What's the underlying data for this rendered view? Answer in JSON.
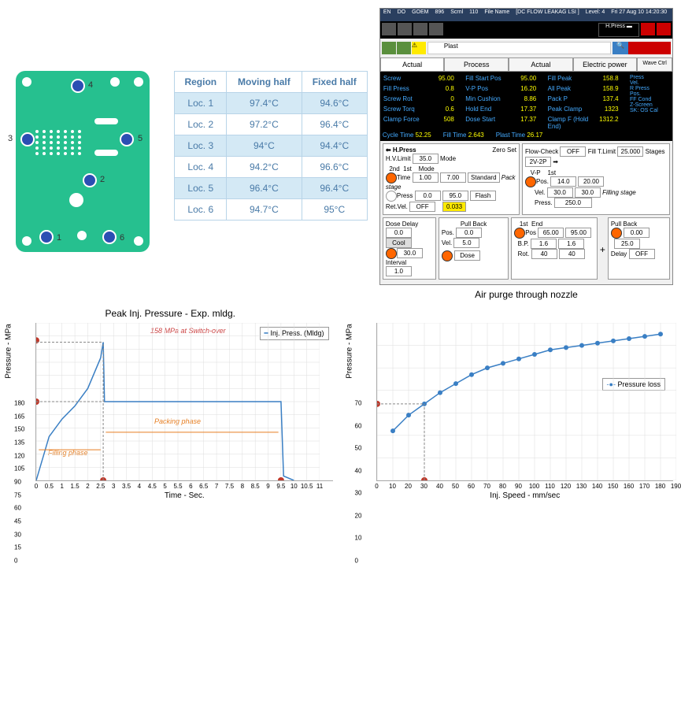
{
  "pcb": {
    "labels": [
      "1",
      "2",
      "3",
      "4",
      "5",
      "6"
    ]
  },
  "table": {
    "headers": [
      "Region",
      "Moving half",
      "Fixed half"
    ],
    "rows": [
      [
        "Loc. 1",
        "97.4°C",
        "94.6°C"
      ],
      [
        "Loc. 2",
        "97.2°C",
        "96.4°C"
      ],
      [
        "Loc. 3",
        "94°C",
        "94.4°C"
      ],
      [
        "Loc. 4",
        "94.2°C",
        "96.6°C"
      ],
      [
        "Loc. 5",
        "96.4°C",
        "96.4°C"
      ],
      [
        "Loc. 6",
        "94.7°C",
        "95°C"
      ]
    ]
  },
  "hmi": {
    "caption": "Air purge through nozzle",
    "toolbar_items": [
      "EN",
      "DO",
      "GOEM",
      "896",
      "Scrnl",
      "110",
      "File Name",
      "[DC FLOW LEAKAG LSI ]",
      "Level: 4",
      "Fri 27 Aug 10 14:20:30"
    ],
    "search_text": "Plast",
    "tabs": [
      "Actual",
      "Process",
      "Actual",
      "Electric power"
    ],
    "wave_label": "Wave Ctrl",
    "rows_left": [
      {
        "l": "Screw",
        "v": "95.00"
      },
      {
        "l": "Fill Press",
        "v": "0.8"
      },
      {
        "l": "Screw Rot",
        "v": "0"
      },
      {
        "l": "Screw Torq",
        "v": "0.6"
      },
      {
        "l": "Clamp Force",
        "v": "508"
      }
    ],
    "rows_mid": [
      {
        "l": "Fill Start Pos",
        "v": "95.00"
      },
      {
        "l": "V-P Pos",
        "v": "16.20"
      },
      {
        "l": "Min Cushion",
        "v": "8.86"
      },
      {
        "l": "Hold End",
        "v": "17.37"
      },
      {
        "l": "Dose Start",
        "v": "17.37"
      }
    ],
    "rows_right": [
      {
        "l": "Fill Peak",
        "v": "158.8"
      },
      {
        "l": "All Peak",
        "v": "158.9"
      },
      {
        "l": "Pack P",
        "v": "137.4"
      },
      {
        "l": "Peak Clamp",
        "v": "1323"
      },
      {
        "l": "Clamp F (Hold End)",
        "v": "1312.2"
      }
    ],
    "side_labels": [
      "Press",
      "Vel.",
      "R Press",
      "Pos.",
      "FF Cond",
      "Z-Screen",
      "SK: OS Cal"
    ],
    "cycle": {
      "l1": "Cycle Time",
      "v1": "52.25",
      "l2": "Fill Time",
      "v2": "2.643",
      "l3": "Plast Time",
      "v3": "26.17"
    },
    "hpress": {
      "title": "H.Press",
      "hv_limit": "35.0",
      "2nd": "1.00",
      "1st": "7.00",
      "time": "1.00",
      "press": "0.0",
      "press2": "95.0",
      "retvel": "OFF",
      "zero_set": "Zero Set",
      "mode": "Mode",
      "pack": "Pack stage",
      "timer": "0.033"
    },
    "flowcheck": {
      "title": "Flow-Check",
      "off": "OFF",
      "fill_limit": "Fill T.Limit",
      "fill_v": "25.000",
      "stages": "Stages",
      "stages_v": "2V-2P",
      "vp": "V-P",
      "1st": "1st",
      "pos": "14.0",
      "pos2": "20.00",
      "vel": "30.0",
      "vel2": "30.0",
      "press": "250.0",
      "fill_stage": "Filling stage"
    },
    "dose": {
      "title": "Dose Delay",
      "dd": "0.0",
      "cool": "Cool",
      "cool_v": "30.0",
      "interval": "Interval",
      "int_v": "1.0"
    },
    "pullback1": {
      "title": "Pull Back",
      "pos": "0.0",
      "vel": "5.0"
    },
    "pullback_mid": {
      "1st": "1st",
      "end": "End",
      "pos1": "65.00",
      "pos2": "95.00",
      "bp1": "1.6",
      "bp2": "1.6",
      "rot1": "40",
      "rot2": "40"
    },
    "pullback2": {
      "title": "Pull Back",
      "pos": "0.00",
      "v2": "25.0",
      "delay": "Delay",
      "delay_v": "OFF"
    },
    "dose_btn": "Dose"
  },
  "chart1": {
    "title": "Peak Inj. Pressure - Exp. mldg.",
    "ylabel": "Pressure - MPa",
    "xlabel": "Time - Sec.",
    "legend": "Inj. Press. (Mldg)",
    "annot1": "158 MPa at Switch-over",
    "annot2": "Filling phase",
    "annot3": "Packing phase"
  },
  "chart2": {
    "ylabel": "Pressure - MPa",
    "xlabel": "Inj. Speed - mm/sec",
    "legend": "Pressure loss"
  },
  "chart_data": [
    {
      "type": "line",
      "title": "Peak Inj. Pressure - Exp. mldg.",
      "xlabel": "Time - Sec.",
      "ylabel": "Pressure - MPa",
      "xlim": [
        0,
        11
      ],
      "ylim": [
        0,
        180
      ],
      "xticks": [
        0,
        0.5,
        1,
        1.5,
        2,
        2.5,
        3,
        3.5,
        4,
        4.5,
        5,
        5.5,
        6,
        6.5,
        7,
        7.5,
        8,
        8.5,
        9,
        9.5,
        10,
        10.5,
        11
      ],
      "yticks": [
        0,
        15,
        30,
        45,
        60,
        75,
        90,
        105,
        120,
        135,
        150,
        165,
        180
      ],
      "series": [
        {
          "name": "Inj. Press. (Mldg)",
          "x": [
            0,
            0.5,
            1,
            1.5,
            2,
            2.5,
            2.6,
            2.65,
            3,
            4,
            5,
            6,
            7,
            8,
            9,
            9.5,
            9.6,
            10
          ],
          "y": [
            0,
            50,
            70,
            85,
            105,
            140,
            158,
            90,
            90,
            90,
            90,
            90,
            90,
            90,
            90,
            90,
            5,
            0
          ]
        }
      ],
      "annotations": [
        {
          "text": "158 MPa at Switch-over",
          "xy": [
            2.6,
            158
          ]
        },
        {
          "text": "Filling phase",
          "range": [
            0,
            2.6
          ]
        },
        {
          "text": "Packing phase",
          "range": [
            2.6,
            9.5
          ]
        }
      ],
      "markers": [
        {
          "x": 0,
          "y": 160,
          "color": "red"
        },
        {
          "x": 0,
          "y": 90,
          "color": "red"
        },
        {
          "x": 2.6,
          "y": 0,
          "color": "red"
        },
        {
          "x": 9.5,
          "y": 0,
          "color": "red"
        }
      ]
    },
    {
      "type": "line",
      "xlabel": "Inj. Speed - mm/sec",
      "ylabel": "Pressure - MPa",
      "xlim": [
        0,
        190
      ],
      "ylim": [
        0,
        70
      ],
      "xticks": [
        0,
        10,
        20,
        30,
        40,
        50,
        60,
        70,
        80,
        90,
        100,
        110,
        120,
        130,
        140,
        150,
        160,
        170,
        180,
        190
      ],
      "yticks": [
        0,
        10,
        20,
        30,
        40,
        50,
        60,
        70
      ],
      "series": [
        {
          "name": "Pressure loss",
          "x": [
            10,
            20,
            30,
            40,
            50,
            60,
            70,
            80,
            90,
            100,
            110,
            120,
            130,
            140,
            150,
            160,
            170,
            180
          ],
          "y": [
            22,
            29,
            34,
            39,
            43,
            47,
            50,
            52,
            54,
            56,
            58,
            59,
            60,
            61,
            62,
            63,
            64,
            65
          ]
        }
      ],
      "markers": [
        {
          "x": 0,
          "y": 34,
          "color": "red"
        },
        {
          "x": 30,
          "y": 0,
          "color": "red"
        }
      ]
    }
  ]
}
